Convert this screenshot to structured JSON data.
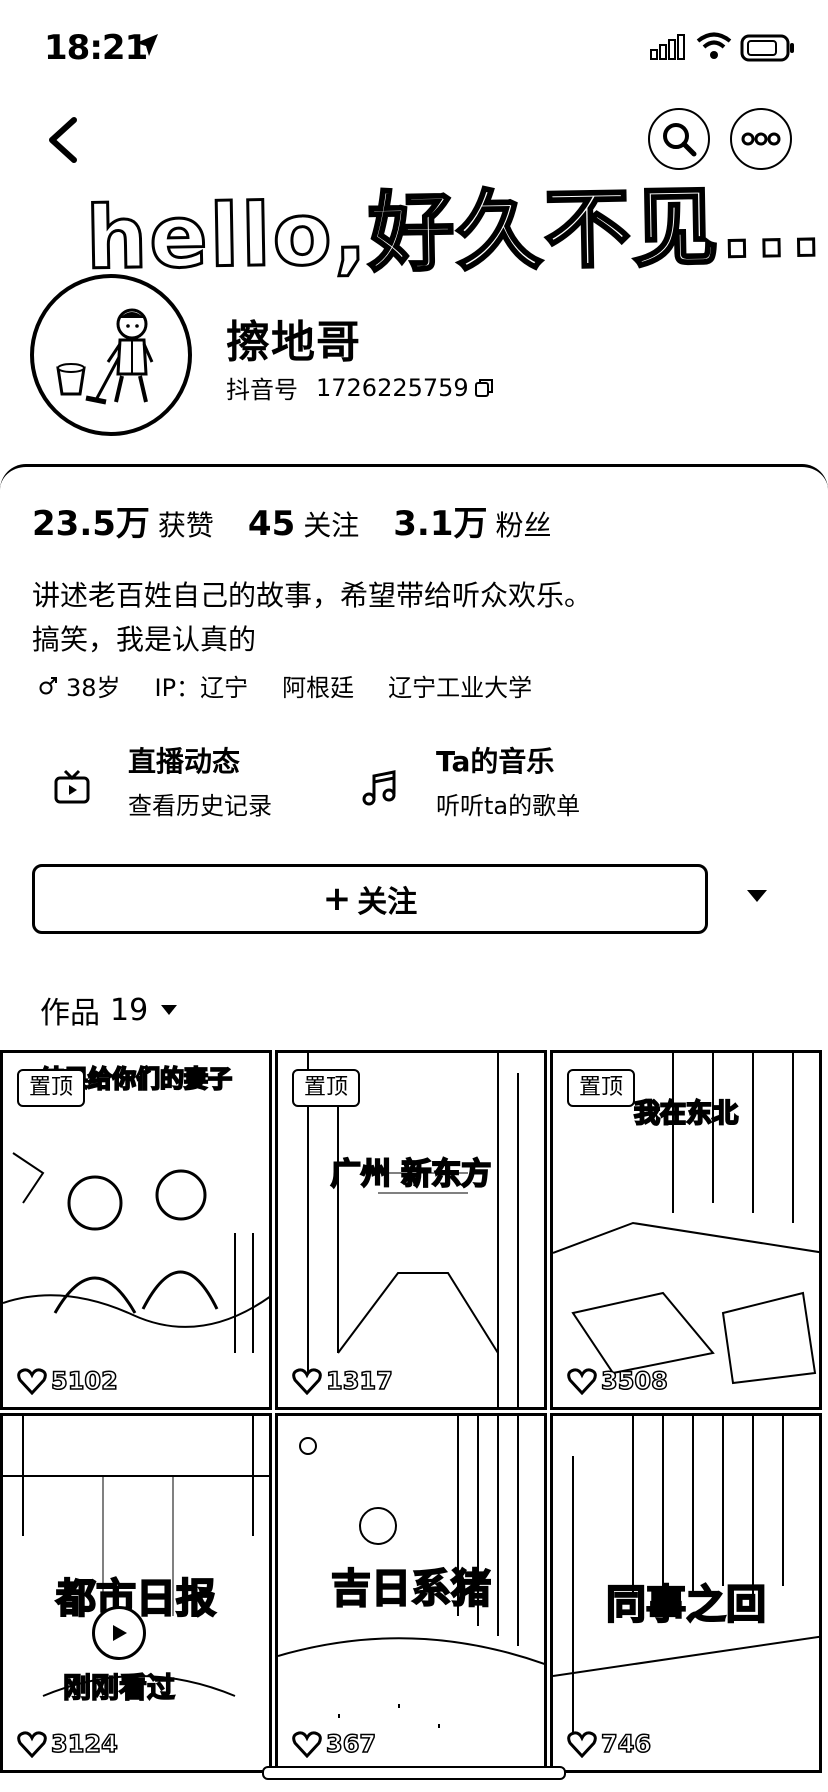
{
  "status_bar": {
    "time": "18:21"
  },
  "banner": {
    "text": "hello,好久不见..."
  },
  "profile": {
    "nickname": "擦地哥",
    "douyin_id_label": "抖音号",
    "douyin_id": "1726225759"
  },
  "stats": [
    {
      "value": "23.5万",
      "label": "获赞"
    },
    {
      "value": "45",
      "label": "关注"
    },
    {
      "value": "3.1万",
      "label": "粉丝"
    }
  ],
  "bio": {
    "line1": "讲述老百姓自己的故事，希望带给听众欢乐。",
    "line2": "搞笑，我是认真的"
  },
  "tags": {
    "age": "38岁",
    "ip": "IP：辽宁",
    "location": "阿根廷",
    "school": "辽宁工业大学"
  },
  "entries": {
    "live": {
      "title": "直播动态",
      "subtitle": "查看历史记录",
      "icon": "tv-icon"
    },
    "music": {
      "title": "Ta的音乐",
      "subtitle": "听听ta的歌单",
      "icon": "music-note-icon"
    }
  },
  "follow_button": {
    "label": "关注"
  },
  "works_tab": {
    "label": "作品",
    "count": "19"
  },
  "videos": [
    {
      "pinned": "置顶",
      "caption": "结果给你们的妻子",
      "likes": "5102"
    },
    {
      "pinned": "置顶",
      "caption": "广州 新东方",
      "likes": "1317"
    },
    {
      "pinned": "置顶",
      "caption": "我在东北",
      "likes": "3508"
    },
    {
      "pinned": "",
      "caption": "都市日报",
      "likes": "3124",
      "recent": "刚刚看过"
    },
    {
      "pinned": "",
      "caption": "吉日系猪",
      "likes": "367"
    },
    {
      "pinned": "",
      "caption": "同事之回",
      "likes": "746"
    }
  ]
}
